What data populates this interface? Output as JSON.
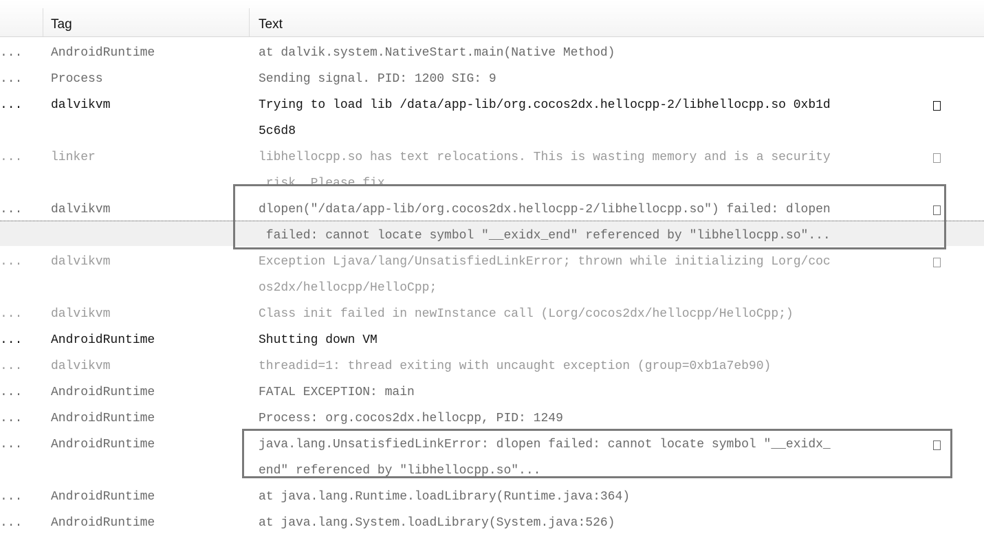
{
  "columns": {
    "tag": "Tag",
    "text": "Text"
  },
  "rows": [
    {
      "level": "...",
      "tag": "AndroidRuntime",
      "lines": [
        "at dalvik.system.NativeStart.main(Native Method)"
      ],
      "tone": "mid"
    },
    {
      "level": "...",
      "tag": "Process",
      "lines": [
        "Sending signal. PID: 1200 SIG: 9"
      ],
      "tone": "mid"
    },
    {
      "level": "...",
      "tag": "dalvikvm",
      "lines": [
        "Trying to load lib /data/app-lib/org.cocos2dx.hellocpp-2/libhellocpp.so 0xb1d",
        "5c6d8"
      ],
      "tone": "dark",
      "wrapped": true
    },
    {
      "level": "...",
      "tag": "linker",
      "lines": [
        "libhellocpp.so has text relocations. This is wasting memory and is a security",
        " risk. Please fix."
      ],
      "tone": "dim",
      "wrapped": true
    },
    {
      "level": "...",
      "tag": "dalvikvm",
      "lines": [
        "dlopen(\"/data/app-lib/org.cocos2dx.hellocpp-2/libhellocpp.so\") failed: dlopen",
        " failed: cannot locate symbol \"__exidx_end\" referenced by \"libhellocpp.so\"..."
      ],
      "tone": "mid",
      "wrapped": true,
      "selected": true
    },
    {
      "level": "...",
      "tag": "dalvikvm",
      "lines": [
        "Exception Ljava/lang/UnsatisfiedLinkError; thrown while initializing Lorg/coc",
        "os2dx/hellocpp/HelloCpp;"
      ],
      "tone": "dim",
      "wrapped": true
    },
    {
      "level": "...",
      "tag": "dalvikvm",
      "lines": [
        "Class init failed in newInstance call (Lorg/cocos2dx/hellocpp/HelloCpp;)"
      ],
      "tone": "dim"
    },
    {
      "level": "...",
      "tag": "AndroidRuntime",
      "lines": [
        "Shutting down VM"
      ],
      "tone": "dark"
    },
    {
      "level": "...",
      "tag": "dalvikvm",
      "lines": [
        "threadid=1: thread exiting with uncaught exception (group=0xb1a7eb90)"
      ],
      "tone": "dim"
    },
    {
      "level": "...",
      "tag": "AndroidRuntime",
      "lines": [
        "FATAL EXCEPTION: main"
      ],
      "tone": "mid"
    },
    {
      "level": "...",
      "tag": "AndroidRuntime",
      "lines": [
        "Process: org.cocos2dx.hellocpp, PID: 1249"
      ],
      "tone": "mid"
    },
    {
      "level": "...",
      "tag": "AndroidRuntime",
      "lines": [
        "java.lang.UnsatisfiedLinkError: dlopen failed: cannot locate symbol \"__exidx_",
        "end\" referenced by \"libhellocpp.so\"..."
      ],
      "tone": "mid",
      "wrapped": true
    },
    {
      "level": "...",
      "tag": "AndroidRuntime",
      "lines": [
        "at java.lang.Runtime.loadLibrary(Runtime.java:364)"
      ],
      "tone": "mid"
    },
    {
      "level": "...",
      "tag": "AndroidRuntime",
      "lines": [
        "at java.lang.System.loadLibrary(System.java:526)"
      ],
      "tone": "mid"
    }
  ],
  "colors": {
    "highlight_box": "#7a7a7a",
    "selected_row_bg": "#f0f0f0"
  }
}
